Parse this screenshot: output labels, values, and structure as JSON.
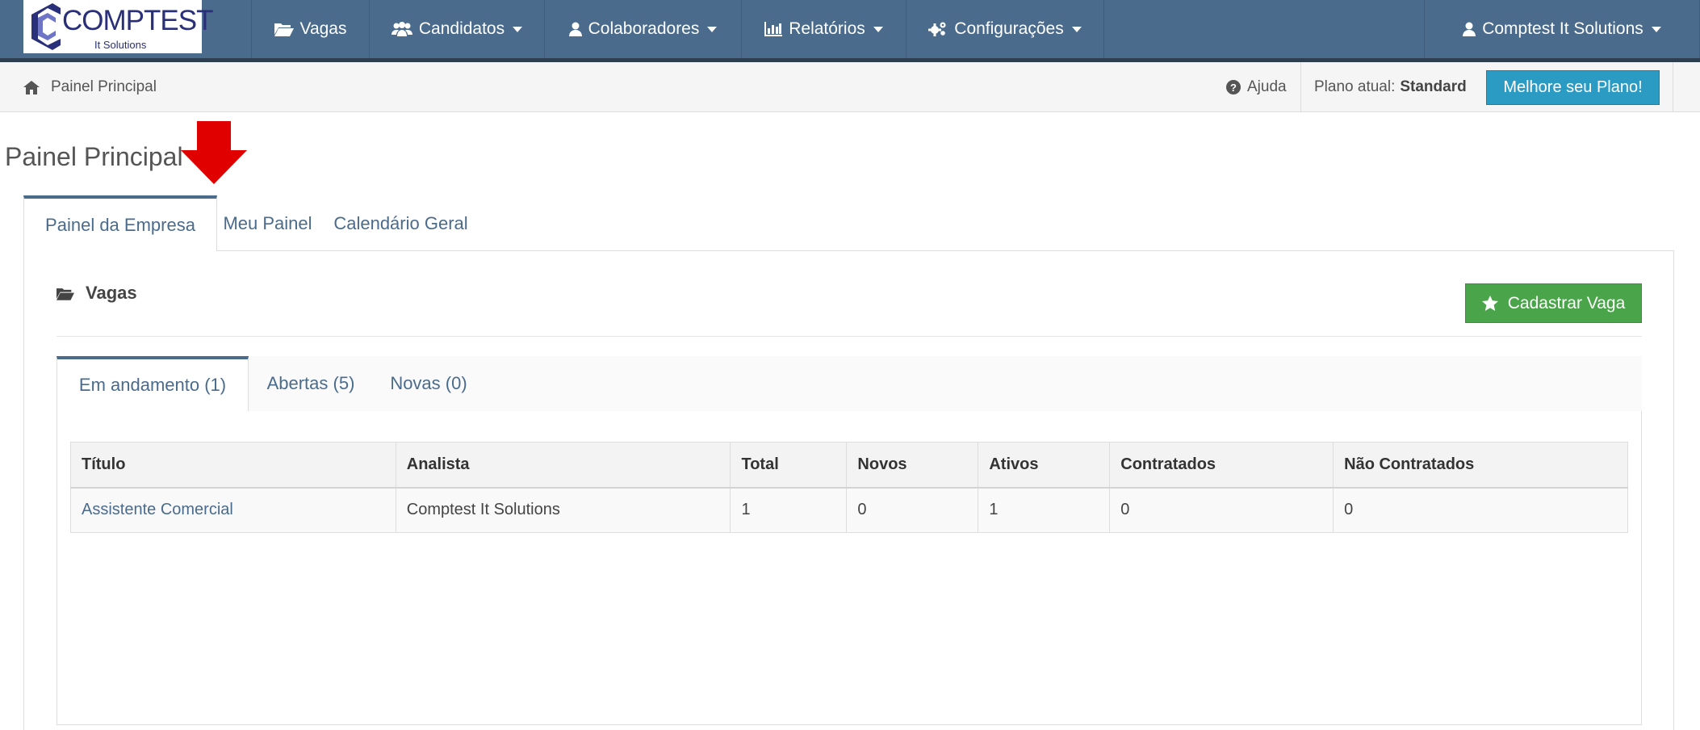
{
  "logo": {
    "title": "COMPTEST",
    "subtitle": "It Solutions"
  },
  "nav": {
    "items": [
      {
        "label": "Vagas",
        "icon": "folder-open-icon",
        "dropdown": false
      },
      {
        "label": "Candidatos",
        "icon": "users-icon",
        "dropdown": true
      },
      {
        "label": "Colaboradores",
        "icon": "user-icon",
        "dropdown": true
      },
      {
        "label": "Relatórios",
        "icon": "bar-chart-icon",
        "dropdown": true
      },
      {
        "label": "Configurações",
        "icon": "cogs-icon",
        "dropdown": true
      }
    ],
    "account": {
      "label": "Comptest It Solutions",
      "icon": "user-icon"
    }
  },
  "breadcrumb": {
    "label": "Painel Principal",
    "icon": "home-icon"
  },
  "help": {
    "label": "Ajuda",
    "icon": "question-circle-icon"
  },
  "plan": {
    "prefix": "Plano atual:",
    "value": "Standard"
  },
  "upgrade_button": "Melhore seu Plano!",
  "page_title": "Painel Principal",
  "outer_tabs": [
    {
      "label": "Painel da Empresa",
      "active": true
    },
    {
      "label": "Meu Painel",
      "active": false
    },
    {
      "label": "Calendário Geral",
      "active": false
    }
  ],
  "section": {
    "title": "Vagas",
    "icon": "folder-open-icon"
  },
  "add_button": {
    "label": "Cadastrar Vaga",
    "icon": "star-icon"
  },
  "inner_tabs": [
    {
      "label": "Em andamento (1)",
      "active": true
    },
    {
      "label": "Abertas (5)",
      "active": false
    },
    {
      "label": "Novas (0)",
      "active": false
    }
  ],
  "table": {
    "headers": [
      "Título",
      "Analista",
      "Total",
      "Novos",
      "Ativos",
      "Contratados",
      "Não Contratados"
    ],
    "rows": [
      [
        "Assistente Comercial",
        "Comptest It Solutions",
        "1",
        "0",
        "1",
        "0",
        "0"
      ]
    ]
  },
  "colors": {
    "navbar": "#4a6b8c",
    "upgrade": "#2b9bc4",
    "add": "#4aa54a",
    "arrow": "#e00000"
  }
}
